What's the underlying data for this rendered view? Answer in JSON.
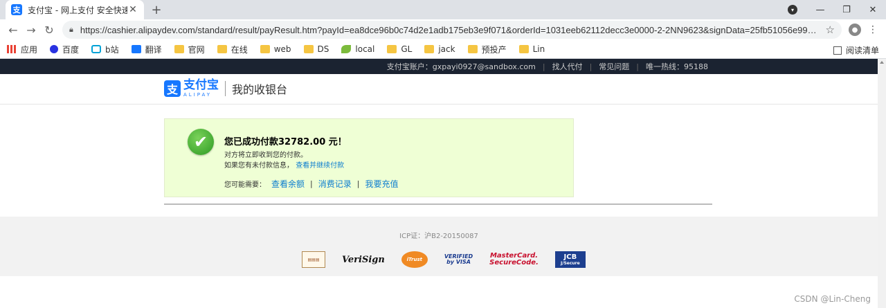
{
  "browser": {
    "tab_title": "支付宝 - 网上支付 安全快速!",
    "tab_favicon": "支",
    "url": "https://cashier.alipaydev.com/standard/result/payResult.htm?payId=ea8dce96b0c74d2e1adb175eb3e9f071&orderId=1031eeb62112decc3e0000-2-2NN9623&signData=25fb51056e9900f51...",
    "bookmarks": [
      "应用",
      "百度",
      "b站",
      "翻译",
      "官网",
      "在线",
      "web",
      "DS",
      "local",
      "GL",
      "jack",
      "预投产",
      "Lin"
    ],
    "reading_list": "阅读清单"
  },
  "topbar": {
    "account": "支付宝账户：gxpayi0927@sandbox.com",
    "find_agent": "找人代付",
    "faq": "常见问题",
    "hotline": "唯一热线：95188"
  },
  "header": {
    "logo_cn": "支付宝",
    "logo_en": "ALIPAY",
    "subtitle": "我的收银台"
  },
  "result": {
    "title": "您已成功付款32782.00 元！",
    "line1": "对方将立即收到您的付款。",
    "line2_prefix": "如果您有未付款信息，",
    "line2_link": "查看并继续付款",
    "maybe_need": "您可能需要：",
    "actions": [
      "查看余额",
      "消费记录",
      "我要充值"
    ]
  },
  "footer": {
    "icp": "ICP证：沪B2-20150087",
    "certs": {
      "verisign": "VeriSign",
      "itrust": "iTrust",
      "visa_1": "VERIFIED",
      "visa_2": "by VISA",
      "mc_1": "MasterCard.",
      "mc_2": "SecureCode.",
      "jcb_1": "JCB",
      "jcb_2": "J/Secure"
    }
  },
  "watermark": "CSDN @Lin-Cheng"
}
